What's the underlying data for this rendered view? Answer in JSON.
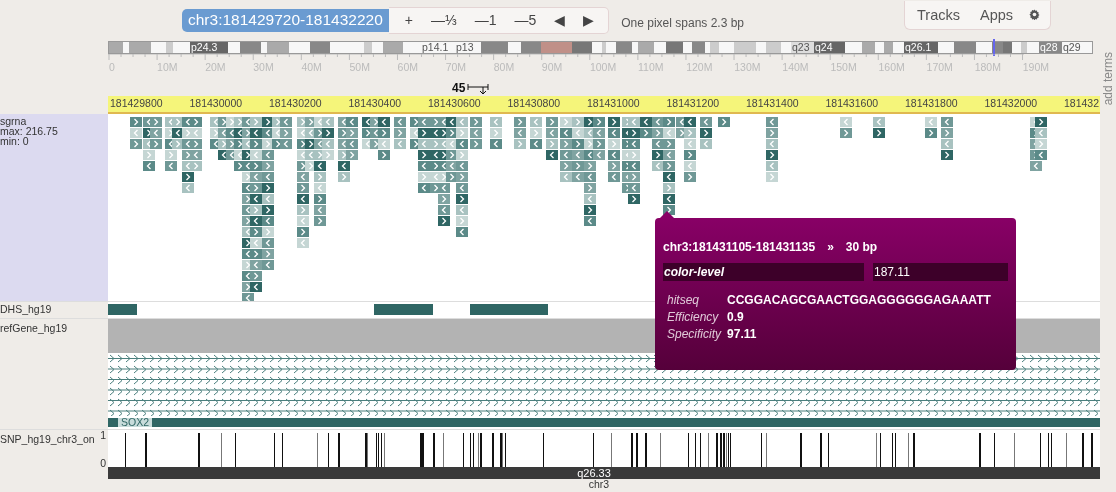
{
  "toolbar": {
    "location": "chr3:181429720-181432220",
    "buttons": [
      "+",
      "—⅓",
      "—1",
      "—5",
      "◀",
      "▶"
    ],
    "resolution": "One pixel spans 2.3 bp",
    "menu": [
      "Tracks",
      "Apps"
    ]
  },
  "ideogram": {
    "bands": [
      "p24.3",
      "p14.1",
      "p13",
      "q23",
      "q24",
      "q26.1",
      "q28",
      "q29"
    ],
    "ticks": [
      "0",
      "10M",
      "20M",
      "30M",
      "40M",
      "50M",
      "60M",
      "70M",
      "80M",
      "90M",
      "100M",
      "110M",
      "120M",
      "130M",
      "140M",
      "150M",
      "160M",
      "170M",
      "180M",
      "190M"
    ]
  },
  "ruler": {
    "scale": "45",
    "positions": [
      "181429800",
      "181430000",
      "181430200",
      "181430400",
      "181430600",
      "181430800",
      "181431000",
      "181431200",
      "181431400",
      "181431600",
      "181431800",
      "181432000",
      "181432"
    ]
  },
  "side_tab": "add terms",
  "tracks": [
    {
      "kind": "sgrna",
      "label": "sgrna",
      "max": "max: 216.75",
      "min": "min: 0"
    },
    {
      "kind": "dhs",
      "label": "DHS_hg19"
    },
    {
      "kind": "gene",
      "label": "refGene_hg19",
      "gene": "SOX2"
    },
    {
      "kind": "snp",
      "label": "SNP_hg19_chr3_on",
      "ymax": "1",
      "ymin": "0"
    }
  ],
  "chromosome_bar": {
    "band": "q26.33",
    "chromosome": "chr3"
  },
  "tooltip": {
    "title": "chr3:181431105-181431135",
    "strand": "»",
    "length": "30 bp",
    "highlight": {
      "name": "color-level",
      "value": "187.11"
    },
    "fields": [
      {
        "name": "hitseq",
        "value": "CCGGACAGCGAACTGGAGGGGGGAGAAATT"
      },
      {
        "name": "Efficiency",
        "value": "0.9"
      },
      {
        "name": "Specificity",
        "value": "97.11"
      }
    ]
  }
}
